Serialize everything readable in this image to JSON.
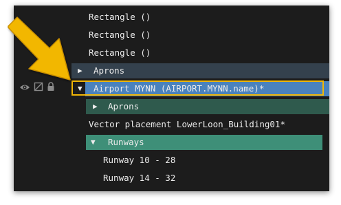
{
  "tree": {
    "rows": [
      {
        "label": "Rectangle ()"
      },
      {
        "label": "Rectangle ()"
      },
      {
        "label": "Rectangle ()"
      },
      {
        "label": "Aprons",
        "toggle": "▶"
      },
      {
        "label": "Airport MYNN (AIRPORT.MYNN.name)*",
        "toggle": "▼"
      },
      {
        "label": "Aprons",
        "toggle": "▶"
      },
      {
        "label": "Vector placement LowerLoon_Building01*"
      },
      {
        "label": "Runways",
        "toggle": "▼"
      },
      {
        "label": "Runway 10 - 28"
      },
      {
        "label": "Runway 14 - 32"
      }
    ]
  },
  "row_icons": [
    "eye-icon",
    "hidden-toggle-icon",
    "lock-icon"
  ],
  "colors": {
    "panel_bg": "#1c1c1c",
    "aprons_row_bg": "#34414d",
    "selected_row_bg": "#4a82bd",
    "child_aprons_bg": "#2f5a4d",
    "runways_bg": "#3e8f78",
    "highlight_border": "#f2b705",
    "arrow": "#f2b705"
  }
}
